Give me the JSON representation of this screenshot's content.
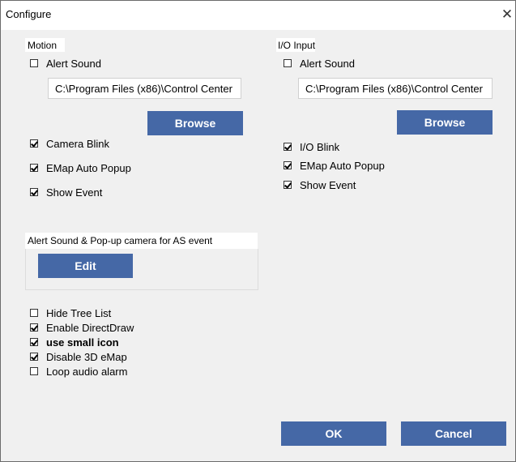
{
  "window": {
    "title": "Configure",
    "close_glyph": "✕"
  },
  "motion": {
    "header": "Motion",
    "alert_sound": {
      "label": "Alert Sound",
      "checked": false
    },
    "path": "C:\\Program Files (x86)\\Control Center",
    "browse": "Browse",
    "camera_blink": {
      "label": "Camera Blink",
      "checked": true
    },
    "emap_auto_popup": {
      "label": "EMap Auto Popup",
      "checked": true
    },
    "show_event": {
      "label": "Show Event",
      "checked": true
    }
  },
  "io_input": {
    "header": "I/O Input",
    "alert_sound": {
      "label": "Alert Sound",
      "checked": false
    },
    "path": "C:\\Program Files (x86)\\Control Center",
    "browse": "Browse",
    "io_blink": {
      "label": "I/O Blink",
      "checked": true
    },
    "emap_auto_popup": {
      "label": "EMap Auto Popup",
      "checked": true
    },
    "show_event": {
      "label": "Show Event",
      "checked": true
    }
  },
  "as_event": {
    "header": "Alert Sound & Pop-up camera for AS event",
    "edit": "Edit"
  },
  "options": [
    {
      "label": "Hide Tree List",
      "checked": false,
      "bold": false
    },
    {
      "label": "Enable DirectDraw",
      "checked": true,
      "bold": false
    },
    {
      "label": "use small icon",
      "checked": true,
      "bold": true
    },
    {
      "label": "Disable 3D eMap",
      "checked": true,
      "bold": false
    },
    {
      "label": "Loop audio alarm",
      "checked": false,
      "bold": false
    }
  ],
  "footer": {
    "ok": "OK",
    "cancel": "Cancel"
  },
  "colors": {
    "button": "#4568a6",
    "dialog_bg": "#f0f0f0"
  }
}
